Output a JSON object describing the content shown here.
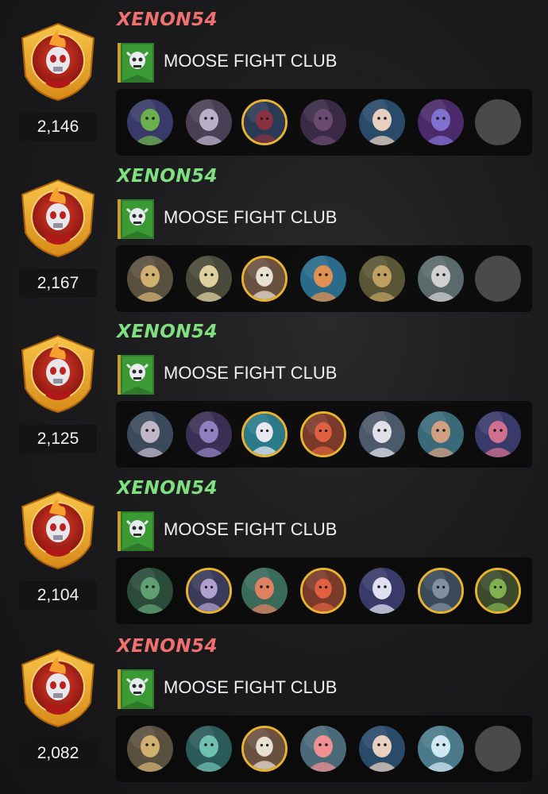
{
  "battles": [
    {
      "player": "XENON54",
      "player_color": "#f07070",
      "rating": "2,146",
      "guild": "MOOSE FIGHT CLUB",
      "team": [
        {
          "icon": "green-goblin-mage-portrait",
          "bg": "#3a3a6a",
          "fg": "#6ab04c",
          "gold": false
        },
        {
          "icon": "armored-knight-portrait",
          "bg": "#4a4055",
          "fg": "#b8b0c8",
          "gold": false
        },
        {
          "icon": "dark-mushroom-creature-portrait",
          "bg": "#2a3a55",
          "fg": "#8a3040",
          "gold": true
        },
        {
          "icon": "shadow-bat-portrait",
          "bg": "#3a2a45",
          "fg": "#6a4a70",
          "gold": false
        },
        {
          "icon": "blue-haired-swordsman-portrait",
          "bg": "#2a4a6a",
          "fg": "#e8d0c0",
          "gold": false
        },
        {
          "icon": "hooded-void-mage-portrait",
          "bg": "#4a2a6a",
          "fg": "#8070d0",
          "gold": false
        },
        {
          "icon": "empty-slot",
          "empty": true
        }
      ]
    },
    {
      "player": "XENON54",
      "player_color": "#7fe07f",
      "rating": "2,167",
      "guild": "MOOSE FIGHT CLUB",
      "team": [
        {
          "icon": "blonde-warrior-portrait",
          "bg": "#5a5040",
          "fg": "#d0b070",
          "gold": false
        },
        {
          "icon": "golden-knight-portrait",
          "bg": "#4a4a3a",
          "fg": "#e0d0a0",
          "gold": false
        },
        {
          "icon": "white-haired-elder-portrait",
          "bg": "#6a5040",
          "fg": "#e8e0d0",
          "gold": true
        },
        {
          "icon": "ice-sorceress-portrait",
          "bg": "#2a6a8a",
          "fg": "#e09050",
          "gold": false
        },
        {
          "icon": "temple-priest-portrait",
          "bg": "#5a5535",
          "fg": "#c0a060",
          "gold": false
        },
        {
          "icon": "grey-wolf-portrait",
          "bg": "#5a6a6a",
          "fg": "#d0d0d0",
          "gold": false
        },
        {
          "icon": "empty-slot",
          "empty": true
        }
      ]
    },
    {
      "player": "XENON54",
      "player_color": "#7fe07f",
      "rating": "2,125",
      "guild": "MOOSE FIGHT CLUB",
      "team": [
        {
          "icon": "silver-haired-assassin-portrait",
          "bg": "#3a4a5a",
          "fg": "#c0b8c8",
          "gold": false
        },
        {
          "icon": "purple-dragon-warrior-portrait",
          "bg": "#3a3055",
          "fg": "#9080c0",
          "gold": false
        },
        {
          "icon": "white-sea-serpent-portrait",
          "bg": "#2a7a8a",
          "fg": "#e8e8f0",
          "gold": true
        },
        {
          "icon": "crimson-beast-portrait",
          "bg": "#7a3a2a",
          "fg": "#e06040",
          "gold": true
        },
        {
          "icon": "white-griffin-portrait",
          "bg": "#4a5a6a",
          "fg": "#e0e0e8",
          "gold": false
        },
        {
          "icon": "brown-haired-heroine-portrait",
          "bg": "#3a6a7a",
          "fg": "#d0a080",
          "gold": false
        },
        {
          "icon": "pink-haired-rogue-portrait",
          "bg": "#3a3a6a",
          "fg": "#d07090",
          "gold": false
        }
      ]
    },
    {
      "player": "XENON54",
      "player_color": "#7fe07f",
      "rating": "2,104",
      "guild": "MOOSE FIGHT CLUB",
      "team": [
        {
          "icon": "forest-ranger-portrait",
          "bg": "#2a4a3a",
          "fg": "#60a070",
          "gold": false
        },
        {
          "icon": "lavender-mouse-portrait",
          "bg": "#3a3a5a",
          "fg": "#b0a0d0",
          "gold": true
        },
        {
          "icon": "coral-sea-creature-portrait",
          "bg": "#3a6a5a",
          "fg": "#e08060",
          "gold": false
        },
        {
          "icon": "crimson-beast-portrait",
          "bg": "#7a3a2a",
          "fg": "#e06040",
          "gold": true
        },
        {
          "icon": "white-unicorn-portrait",
          "bg": "#3a3a6a",
          "fg": "#e0e0f0",
          "gold": false
        },
        {
          "icon": "storm-wizard-portrait",
          "bg": "#3a4a5a",
          "fg": "#8090a0",
          "gold": true
        },
        {
          "icon": "green-goblin-chief-portrait",
          "bg": "#3a4a2a",
          "fg": "#80b050",
          "gold": true
        }
      ]
    },
    {
      "player": "XENON54",
      "player_color": "#f07070",
      "rating": "2,082",
      "guild": "MOOSE FIGHT CLUB",
      "team": [
        {
          "icon": "blonde-warrior-portrait",
          "bg": "#5a5040",
          "fg": "#d0b070",
          "gold": false
        },
        {
          "icon": "glass-tank-creature-portrait",
          "bg": "#2a5a5a",
          "fg": "#70c0b0",
          "gold": false
        },
        {
          "icon": "white-haired-elder-portrait",
          "bg": "#6a5040",
          "fg": "#e8e0d0",
          "gold": true
        },
        {
          "icon": "pink-mermaid-portrait",
          "bg": "#4a6a7a",
          "fg": "#f09090",
          "gold": false
        },
        {
          "icon": "blue-haired-swordsman-portrait",
          "bg": "#2a4a6a",
          "fg": "#e8d0c0",
          "gold": false
        },
        {
          "icon": "frost-spirit-portrait",
          "bg": "#4a7a8a",
          "fg": "#d0e8f0",
          "gold": false
        },
        {
          "icon": "empty-slot",
          "empty": true
        }
      ]
    }
  ]
}
